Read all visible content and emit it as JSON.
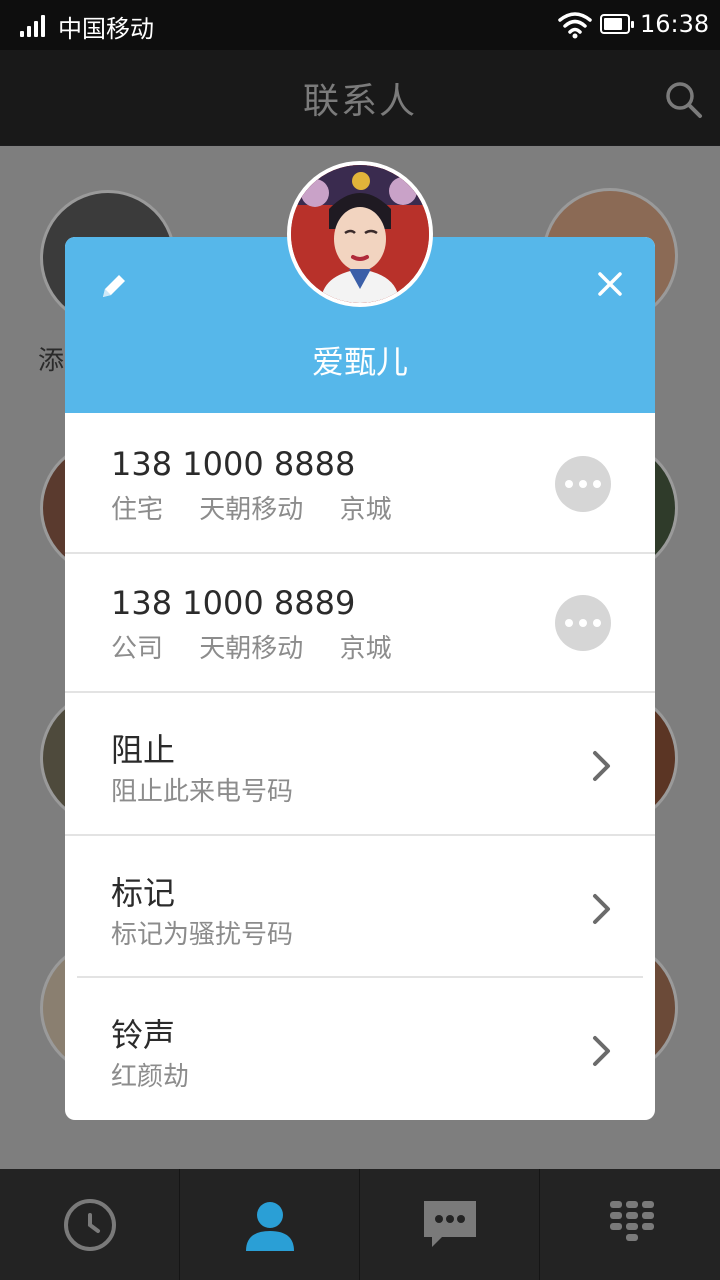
{
  "status_bar": {
    "carrier": "中国移动",
    "time": "16:38"
  },
  "header": {
    "title": "联系人"
  },
  "background": {
    "add_label": "添"
  },
  "contact_card": {
    "name": "爱甄儿",
    "phones": [
      {
        "number": "138 1000 8888",
        "type": "住宅",
        "carrier": "天朝移动",
        "location": "京城"
      },
      {
        "number": "138 1000 8889",
        "type": "公司",
        "carrier": "天朝移动",
        "location": "京城"
      }
    ],
    "actions": [
      {
        "title": "阻止",
        "subtitle": "阻止此来电号码"
      },
      {
        "title": "标记",
        "subtitle": "标记为骚扰号码"
      },
      {
        "title": "铃声",
        "subtitle": "红颜劫"
      }
    ]
  },
  "tab_bar": {
    "icons": [
      "clock-icon",
      "person-icon",
      "message-icon",
      "dialpad-icon"
    ],
    "active_color": "#2a9fd6"
  },
  "colors": {
    "header_blue": "#56b7ea",
    "accent": "#2a9fd6"
  }
}
